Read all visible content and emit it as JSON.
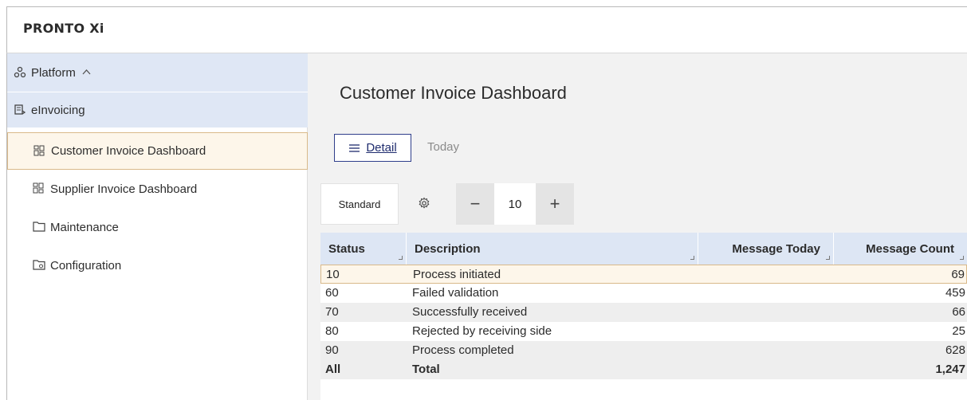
{
  "app": {
    "logo": "PRONTO Xi"
  },
  "sidebar": {
    "platform_label": "Platform",
    "einvoicing_label": "eInvoicing",
    "items": [
      {
        "label": "Customer Invoice Dashboard",
        "icon": "dashboard-icon",
        "active": true
      },
      {
        "label": "Supplier Invoice Dashboard",
        "icon": "dashboard-icon",
        "active": false
      },
      {
        "label": "Maintenance",
        "icon": "folder-icon",
        "active": false
      },
      {
        "label": "Configuration",
        "icon": "folder-settings-icon",
        "active": false
      }
    ]
  },
  "main": {
    "title": "Customer Invoice Dashboard",
    "tabs": {
      "detail": "Detail",
      "today": "Today"
    },
    "toolbar": {
      "view": "Standard",
      "page_size": "10",
      "minus": "−",
      "plus": "+"
    },
    "table": {
      "headers": {
        "status": "Status",
        "description": "Description",
        "message_today": "Message Today",
        "message_count": "Message Count"
      },
      "rows": [
        {
          "status": "10",
          "description": "Process initiated",
          "message_today": "",
          "message_count": "69"
        },
        {
          "status": "60",
          "description": "Failed validation",
          "message_today": "",
          "message_count": "459"
        },
        {
          "status": "70",
          "description": "Successfully received",
          "message_today": "",
          "message_count": "66"
        },
        {
          "status": "80",
          "description": "Rejected by receiving side",
          "message_today": "",
          "message_count": "25"
        },
        {
          "status": "90",
          "description": "Process completed",
          "message_today": "",
          "message_count": "628"
        }
      ],
      "total": {
        "status": "All",
        "description": "Total",
        "message_today": "",
        "message_count": "1,247"
      }
    }
  },
  "colors": {
    "accent": "#2f3e8b",
    "nav_group_bg": "#dfe7f5",
    "selected_bg": "#fdf6ea",
    "selected_border": "#d9b98a"
  }
}
